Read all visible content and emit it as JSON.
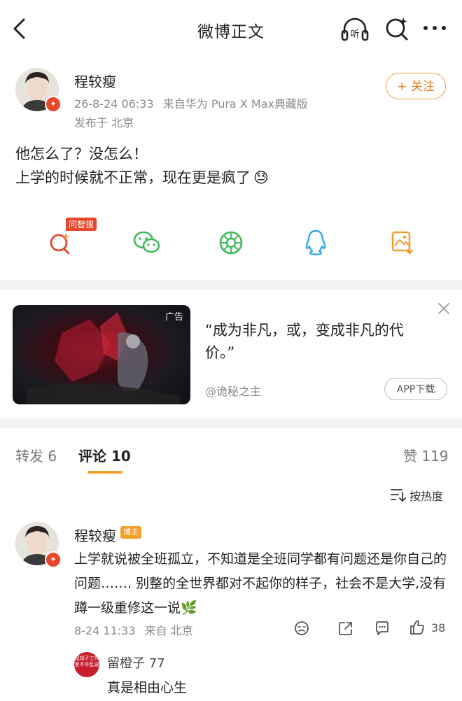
{
  "header": {
    "title": "微博正文",
    "listen_label": "听"
  },
  "post": {
    "author": "程较瘦",
    "time": "26-8-24 06:33",
    "source": "来自华为 Pura X Max典藏版",
    "location": "发布于 北京",
    "follow_label": "+ 关注",
    "text_line1": "他怎么了？没怎么！",
    "text_line2": "上学的时候就不正常，现在更是疯了",
    "emoji": "😓",
    "share_badge": "问智搜"
  },
  "ad": {
    "tag": "广告",
    "text": "“成为非凡，或，变成非凡的代价。”",
    "source": "@诡秘之主",
    "button": "APP下载"
  },
  "tabs": {
    "repost": "转发 6",
    "comments": "评论 10",
    "likes": "赞 119",
    "sort": "按热度"
  },
  "comment": {
    "author": "程较瘦",
    "badge": "博主",
    "text": "上学就说被全班孤立，不知道是全班同学都有问题还是你自己的问题……. 别整的全世界都对不起你的样子，社会不是大学,没有蹲一级重修这一说🌿",
    "time": "8-24 11:33",
    "from": "来自 北京",
    "like_count": "38"
  },
  "reply": {
    "author": "留橙子 77",
    "avatar_text": "程靖子工作室不许乱说",
    "text": "真是相由心生"
  },
  "colors": {
    "accent_orange": "#f0a030",
    "vip_red": "#e8472b",
    "wechat_green": "#3dbb5b",
    "qq_blue": "#2fa8e8"
  }
}
